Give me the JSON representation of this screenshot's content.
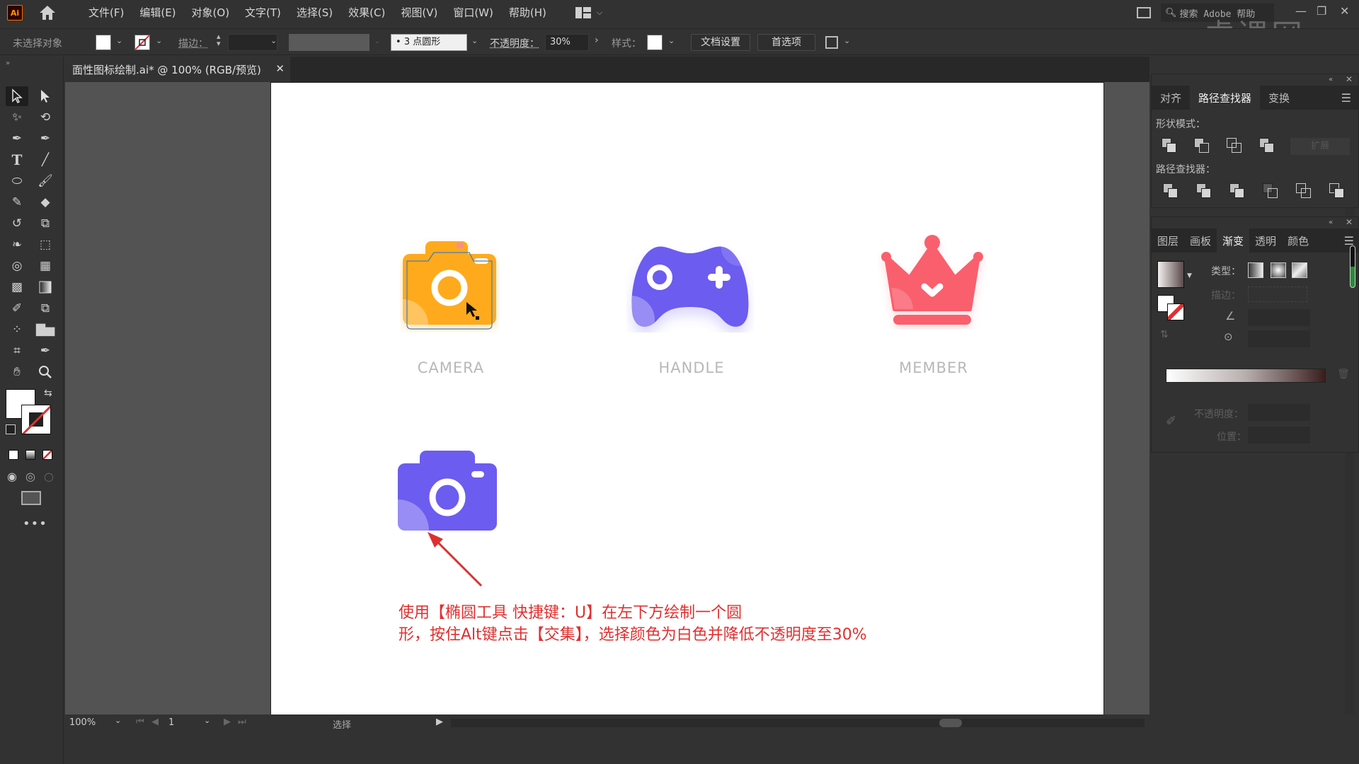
{
  "app": {
    "logo": "Ai",
    "menu": [
      "文件(F)",
      "编辑(E)",
      "对象(O)",
      "文字(T)",
      "选择(S)",
      "效果(C)",
      "视图(V)",
      "窗口(W)",
      "帮助(H)"
    ],
    "search_placeholder": "搜索 Adobe 帮助",
    "watermark": "虎课网"
  },
  "control_bar": {
    "selection_status": "未选择对象",
    "stroke_label": "描边：",
    "brush_label": "3 点圆形",
    "opacity_label": "不透明度：",
    "opacity_value": "30%",
    "style_label": "样式：",
    "doc_setup_button": "文档设置",
    "preferences_button": "首选项"
  },
  "document": {
    "tab_title": "面性图标绘制.ai* @ 100% (RGB/预览)"
  },
  "artboard": {
    "icons": [
      {
        "label": "CAMERA",
        "color": "#FFAA1E"
      },
      {
        "label": "HANDLE",
        "color": "#6C5CF0"
      },
      {
        "label": "MEMBER",
        "color": "#FA5F6E"
      }
    ],
    "work_icon_color": "#6C5CF0",
    "annotation_line1": "使用【椭圆工具 快捷键：U】在左下方绘制一个圆",
    "annotation_line2": "形，按住Alt键点击【交集】，选择颜色为白色并降低不透明度至30%",
    "annotation_color": "#E02F2F"
  },
  "status_bar": {
    "zoom": "100%",
    "artboard_number": "1",
    "tool_status": "选择"
  },
  "pathfinder_panel": {
    "tabs": [
      "对齐",
      "路径查找器",
      "变换"
    ],
    "active_tab": "路径查找器",
    "shape_modes_label": "形状模式：",
    "pathfinders_label": "路径查找器：",
    "expand_button": "扩展"
  },
  "gradient_panel": {
    "tabs": [
      "图层",
      "画板",
      "渐变",
      "透明",
      "颜色"
    ],
    "active_tab": "渐变",
    "type_label": "类型：",
    "stroke_label": "描边：",
    "opacity_label": "不透明度：",
    "location_label": "位置："
  }
}
